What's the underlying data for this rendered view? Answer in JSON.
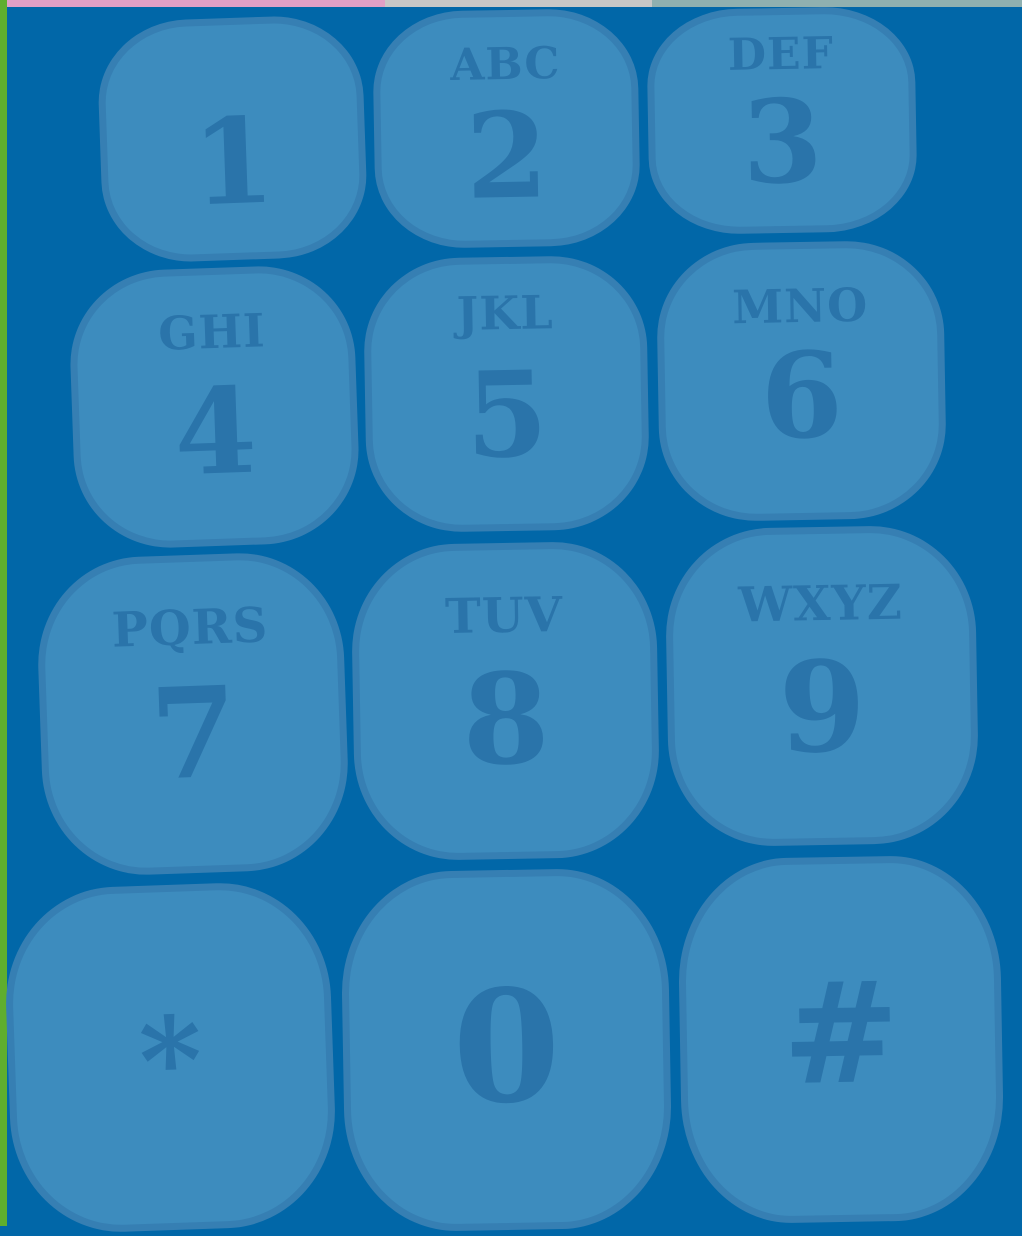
{
  "colors": {
    "background": "#0167a8",
    "key_fill": "#3d8cbe",
    "key_border": "#367fb3",
    "key_text": "#2a74aa",
    "left_bar": "#5fae2e",
    "top_strip": [
      "#e0a0c6",
      "#c7c7c7",
      "#8fb0b0"
    ]
  },
  "keypad": {
    "keys": [
      {
        "digit": "1",
        "letters": ""
      },
      {
        "digit": "2",
        "letters": "ABC"
      },
      {
        "digit": "3",
        "letters": "DEF"
      },
      {
        "digit": "4",
        "letters": "GHI"
      },
      {
        "digit": "5",
        "letters": "JKL"
      },
      {
        "digit": "6",
        "letters": "MNO"
      },
      {
        "digit": "7",
        "letters": "PQRS"
      },
      {
        "digit": "8",
        "letters": "TUV"
      },
      {
        "digit": "9",
        "letters": "WXYZ"
      },
      {
        "digit": "*",
        "letters": ""
      },
      {
        "digit": "0",
        "letters": ""
      },
      {
        "digit": "#",
        "letters": ""
      }
    ]
  }
}
